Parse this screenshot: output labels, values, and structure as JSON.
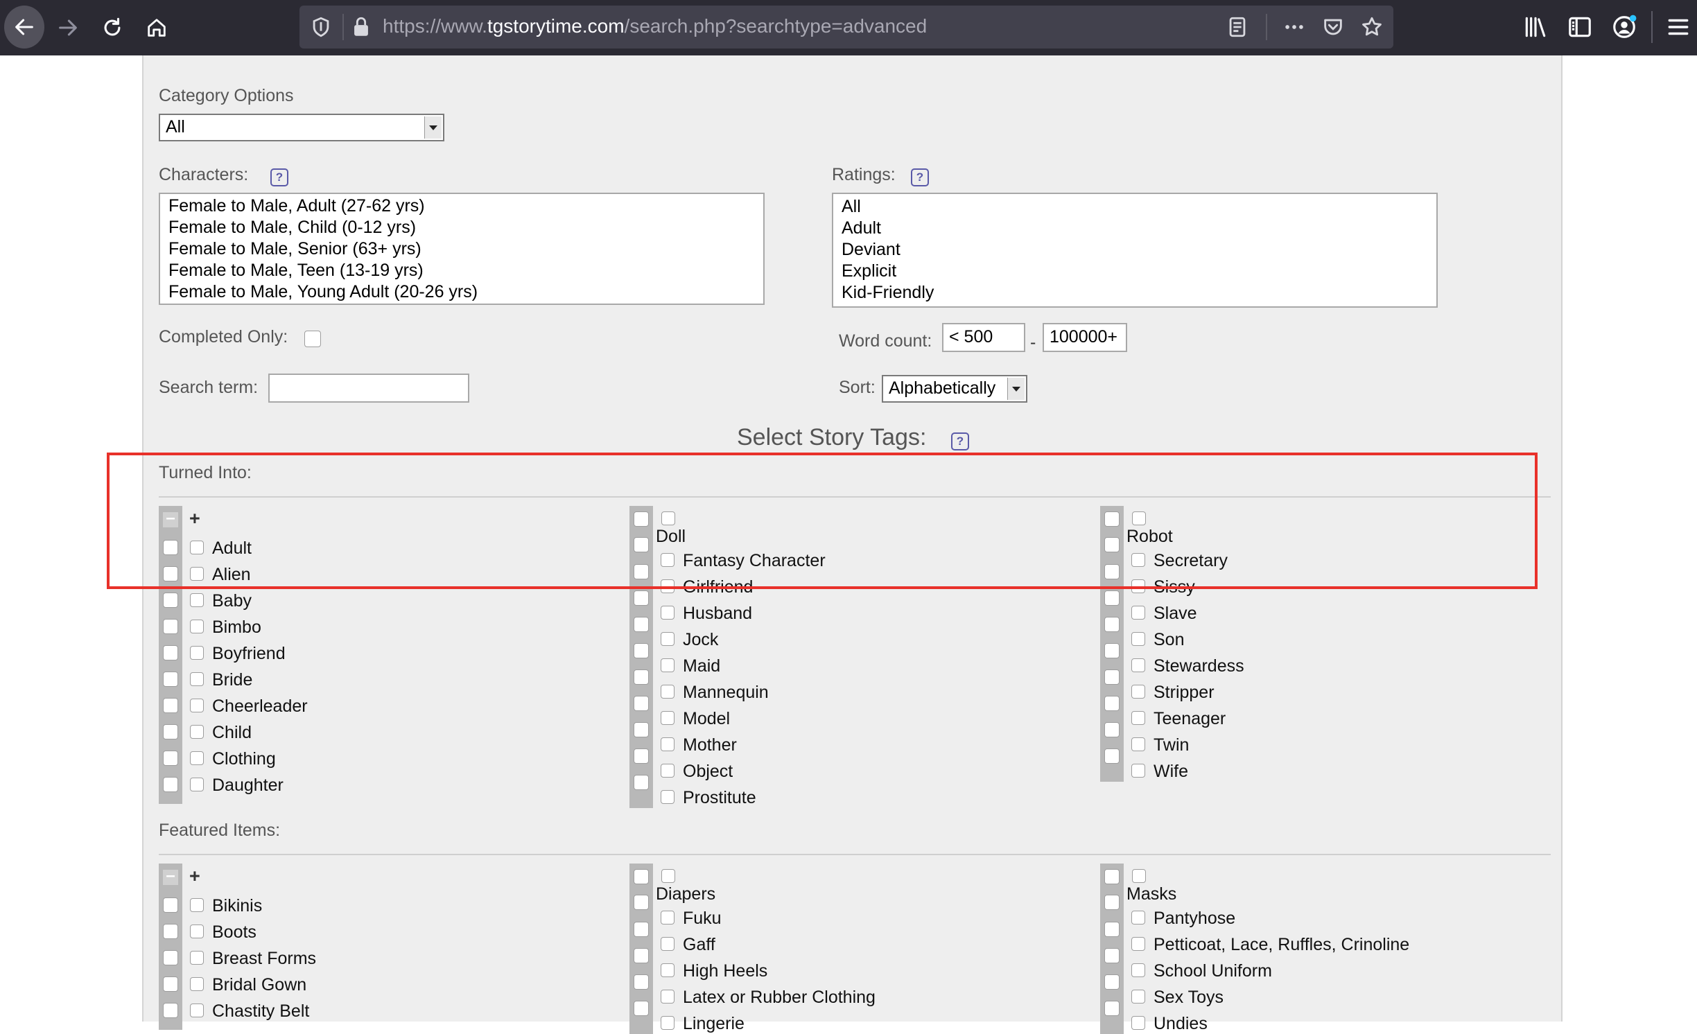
{
  "browser": {
    "url_prefix": "https://www.",
    "url_domain": "tgstorytime.com",
    "url_suffix": "/search.php?searchtype=advanced",
    "icons": [
      "back-icon",
      "forward-icon",
      "reload-icon",
      "home-icon",
      "shield-icon",
      "lock-icon",
      "reader-icon",
      "more-icon",
      "pocket-icon",
      "star-icon",
      "library-icon",
      "sidebar-icon",
      "account-icon",
      "menu-icon"
    ]
  },
  "form": {
    "category_label": "Category Options",
    "category_value": "All",
    "characters_label": "Characters:",
    "characters_options": [
      "Female to Male, Adult (27-62 yrs)",
      "Female to Male, Child (0-12 yrs)",
      "Female to Male, Senior (63+ yrs)",
      "Female to Male, Teen (13-19 yrs)",
      "Female to Male, Young Adult (20-26 yrs)"
    ],
    "ratings_label": "Ratings:",
    "ratings_options": [
      "All",
      "Adult",
      "Deviant",
      "Explicit",
      "Kid-Friendly"
    ],
    "completed_label": "Completed Only:",
    "wordcount_label": "Word count:",
    "wordcount_min": "< 500",
    "wordcount_sep": "-",
    "wordcount_max": "100000+",
    "search_label": "Search term:",
    "search_value": "",
    "sort_label": "Sort:",
    "sort_value": "Alphabetically",
    "help_glyph": "?"
  },
  "tags": {
    "title": "Select Story Tags:",
    "minus": "–",
    "plus": "+",
    "turned_into": {
      "label": "Turned Into:",
      "col1": [
        "Adult",
        "Alien",
        "Baby",
        "Bimbo",
        "Boyfriend",
        "Bride",
        "Cheerleader",
        "Child",
        "Clothing",
        "Daughter"
      ],
      "col2_header": "Doll",
      "col2": [
        "Fantasy Character",
        "Girlfriend",
        "Husband",
        "Jock",
        "Maid",
        "Mannequin",
        "Model",
        "Mother",
        "Object",
        "Prostitute"
      ],
      "col3_header": "Robot",
      "col3": [
        "Secretary",
        "Sissy",
        "Slave",
        "Son",
        "Stewardess",
        "Stripper",
        "Teenager",
        "Twin",
        "Wife"
      ]
    },
    "featured_items": {
      "label": "Featured Items:",
      "col1": [
        "Bikinis",
        "Boots",
        "Breast Forms",
        "Bridal Gown",
        "Chastity Belt"
      ],
      "col2_header": "Diapers",
      "col2": [
        "Fuku",
        "Gaff",
        "High Heels",
        "Latex or Rubber Clothing",
        "Lingerie"
      ],
      "col3_header": "Masks",
      "col3": [
        "Pantyhose",
        "Petticoat, Lace, Ruffles, Crinoline",
        "School Uniform",
        "Sex Toys",
        "Undies"
      ]
    }
  }
}
